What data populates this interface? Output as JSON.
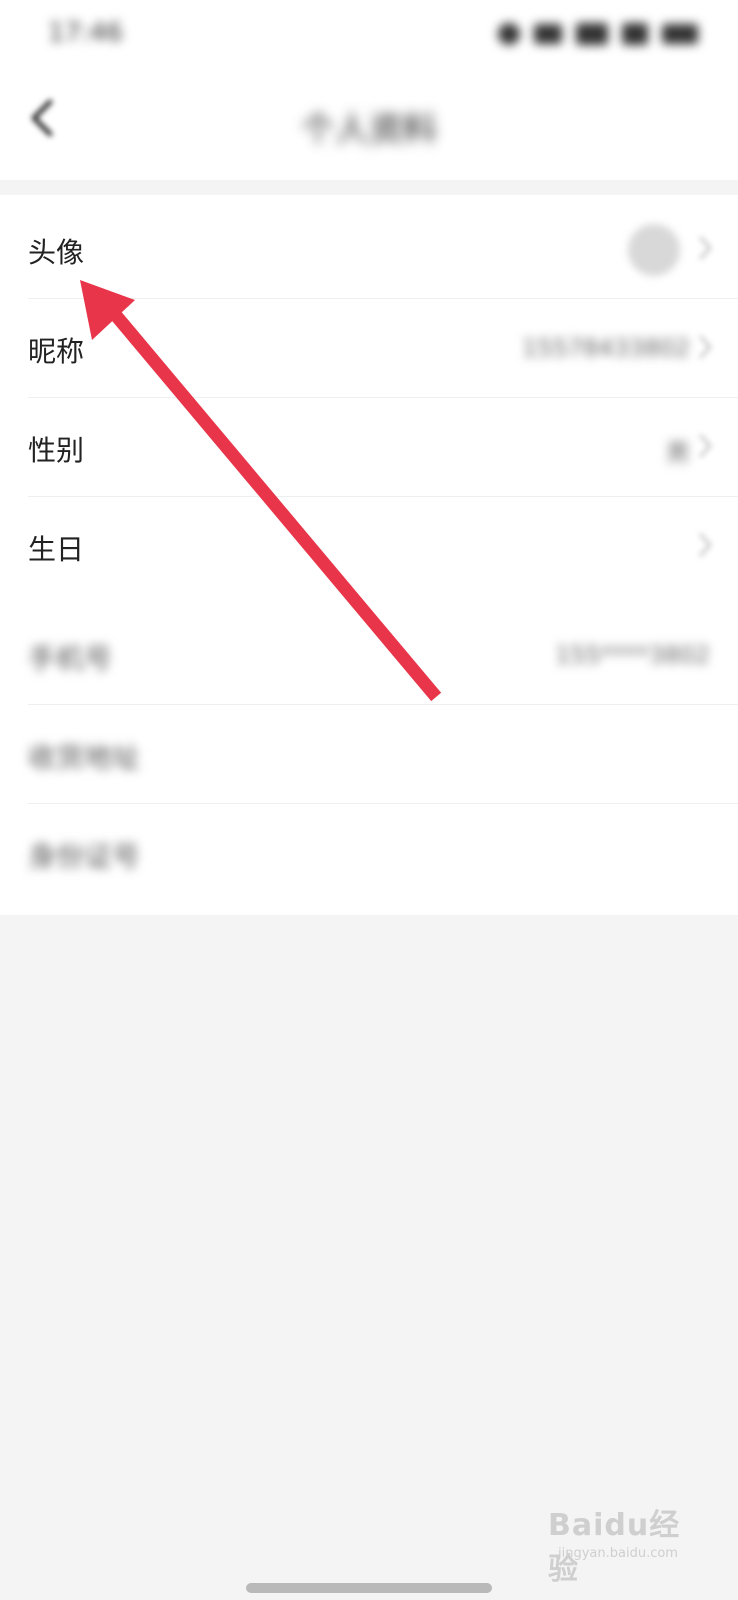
{
  "status_bar": {
    "time": "17:46"
  },
  "header": {
    "title": "个人资料",
    "back_icon": "chevron-left-icon"
  },
  "profile_rows": [
    {
      "label": "头像",
      "value": "",
      "icon": "avatar"
    },
    {
      "label": "昵称",
      "value": "15578433802"
    },
    {
      "label": "性别",
      "value": "男"
    },
    {
      "label": "生日",
      "value": ""
    },
    {
      "label": "手机号",
      "value": "155****3802"
    },
    {
      "label": "收货地址",
      "value": ""
    },
    {
      "label": "身份证号",
      "value": ""
    }
  ],
  "annotation": {
    "arrow_color": "#e8354a"
  },
  "watermark": {
    "main": "Baidu经验",
    "sub": "jingyan.baidu.com"
  }
}
